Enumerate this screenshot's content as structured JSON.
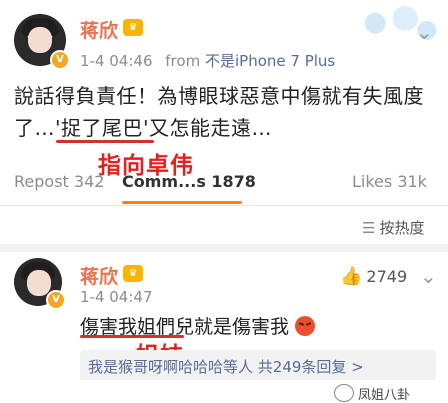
{
  "post": {
    "author": "蒋欣",
    "date": "1-4 04:46",
    "from_prefix": "from",
    "source": "不是iPhone 7 Plus",
    "line1": "說話得負責任！為博眼球惡意中傷就有失風度",
    "line2_pre": "了…'",
    "line2_highlight": "捉了尾巴",
    "line2_post": "'又怎能走遠…",
    "annotation": "指向卓伟"
  },
  "tabs": {
    "repost": "Repost 342",
    "comments": "Comm...s 1878",
    "likes": "Likes 31k"
  },
  "sort": {
    "label": "按热度"
  },
  "comment": {
    "author": "蒋欣",
    "date": "1-4 04:47",
    "likes": "2749",
    "text_highlight": "傷害我姐們兒",
    "text_rest": "就是傷害我",
    "annotation": "姐妹",
    "reply": "我是猴哥呀啊哈哈哈等人  共249条回复 >"
  },
  "watermark": {
    "text": "凤姐八卦"
  },
  "icons": {
    "vip_badge": "vip-crown-icon",
    "verified": "verified-v-icon",
    "thumbs_up": "thumbs-up-icon",
    "more": "more-dots-icon",
    "sort": "sort-lines-icon"
  },
  "colors": {
    "name": "#eb7350",
    "annotation": "#e0211f",
    "tab_indicator": "#ff8200",
    "link": "#586c94"
  }
}
